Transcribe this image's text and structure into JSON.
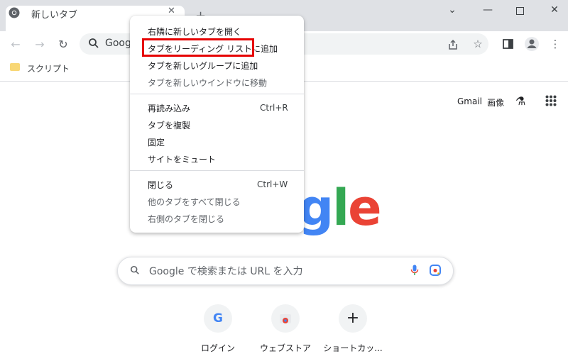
{
  "tab": {
    "title": "新しいタブ"
  },
  "omnibox": {
    "text": "Goog"
  },
  "bookmarks": [
    {
      "label": "スクリプト"
    }
  ],
  "header_links": {
    "gmail": "Gmail",
    "images": "画像"
  },
  "logo": {
    "letters": [
      "g",
      "l",
      "e"
    ],
    "colors": [
      "#4285f4",
      "#34a853",
      "#ea4335"
    ]
  },
  "search": {
    "placeholder": "Google で検索または URL を入力"
  },
  "shortcuts": [
    {
      "label": "ログイン"
    },
    {
      "label": "ウェブストア"
    },
    {
      "label": "ショートカッ..."
    }
  ],
  "context_menu": {
    "items": [
      {
        "label": "右隣に新しいタブを開く",
        "accelerator": "",
        "disabled": false
      },
      {
        "label": "タブをリーディング リストに追加",
        "accelerator": "",
        "disabled": false,
        "highlighted": true
      },
      {
        "label": "タブを新しいグループに追加",
        "accelerator": "",
        "disabled": false
      },
      {
        "label": "タブを新しいウインドウに移動",
        "accelerator": "",
        "disabled": true
      },
      {
        "label": "再読み込み",
        "accelerator": "Ctrl+R",
        "disabled": false
      },
      {
        "label": "タブを複製",
        "accelerator": "",
        "disabled": false
      },
      {
        "label": "固定",
        "accelerator": "",
        "disabled": false
      },
      {
        "label": "サイトをミュート",
        "accelerator": "",
        "disabled": false
      },
      {
        "label": "閉じる",
        "accelerator": "Ctrl+W",
        "disabled": false
      },
      {
        "label": "他のタブをすべて閉じる",
        "accelerator": "",
        "disabled": true
      },
      {
        "label": "右側のタブを閉じる",
        "accelerator": "",
        "disabled": true
      }
    ],
    "highlight_color": "#e60000"
  },
  "icons": [
    "chrome-logo-icon",
    "close-icon",
    "new-tab-icon",
    "minimize-icon",
    "maximize-icon",
    "window-close-icon",
    "back-arrow-icon",
    "forward-arrow-icon",
    "reload-icon",
    "search-icon",
    "share-icon",
    "star-icon",
    "side-panel-icon",
    "profile-icon",
    "menu-icon",
    "folder-icon",
    "labs-flask-icon",
    "apps-grid-icon",
    "mic-icon",
    "lens-icon",
    "google-g-icon",
    "webstore-icon",
    "plus-icon"
  ]
}
